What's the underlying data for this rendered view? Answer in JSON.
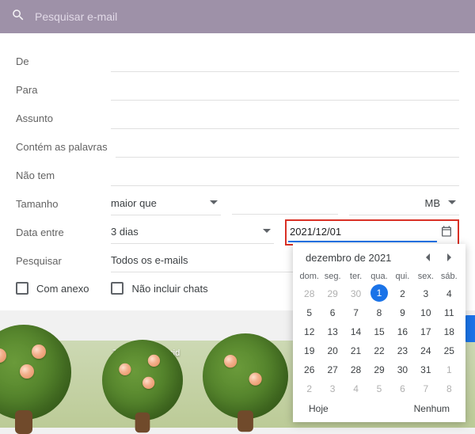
{
  "topbar": {
    "placeholder": "Pesquisar e-mail"
  },
  "form": {
    "from": "De",
    "to": "Para",
    "subject": "Assunto",
    "has_words": "Contém as palavras",
    "no_words": "Não tem",
    "size_label": "Tamanho",
    "size_op": "maior que",
    "size_unit": "MB",
    "date_label": "Data entre",
    "date_range": "3 dias",
    "date_value": "2021/12/01",
    "search_label": "Pesquisar",
    "search_scope": "Todos os e-mails",
    "has_attachment": "Com anexo",
    "exclude_chats": "Não incluir chats"
  },
  "footer": {
    "links": "Termos · Privacid",
    "links2": "e ativid"
  },
  "datepicker": {
    "title": "dezembro de 2021",
    "dow": [
      "dom.",
      "seg.",
      "ter.",
      "qua.",
      "qui.",
      "sex.",
      "sáb."
    ],
    "prev_trail": [
      "28",
      "29",
      "30"
    ],
    "days": [
      "1",
      "2",
      "3",
      "4",
      "5",
      "6",
      "7",
      "8",
      "9",
      "10",
      "11",
      "12",
      "13",
      "14",
      "15",
      "16",
      "17",
      "18",
      "19",
      "20",
      "21",
      "22",
      "23",
      "24",
      "25",
      "26",
      "27",
      "28",
      "29",
      "30",
      "31"
    ],
    "next_lead": [
      "1",
      "2",
      "3",
      "4",
      "5",
      "6",
      "7",
      "8"
    ],
    "selected": "1",
    "today": "Hoje",
    "none": "Nenhum"
  }
}
